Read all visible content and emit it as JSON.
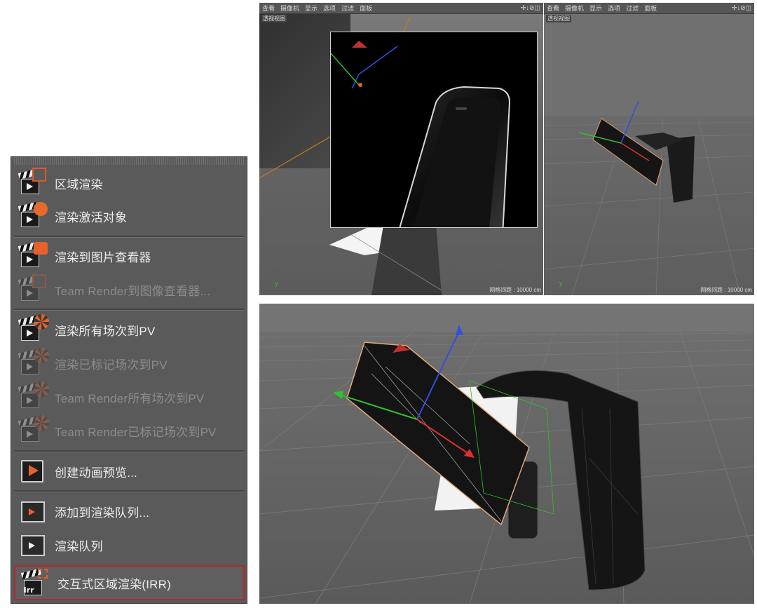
{
  "render_menu": {
    "items": [
      {
        "label": "区域渲染",
        "enabled": true,
        "icon": "region-render-icon"
      },
      {
        "label": "渲染激活对象",
        "enabled": true,
        "icon": "render-active-objects-icon"
      },
      {
        "label": "渲染到图片查看器",
        "enabled": true,
        "icon": "render-to-picture-viewer-icon"
      },
      {
        "label": "Team Render到图像查看器...",
        "enabled": false,
        "icon": "team-render-picture-viewer-icon"
      },
      {
        "label": "渲染所有场次到PV",
        "enabled": true,
        "icon": "render-all-takes-icon"
      },
      {
        "label": "渲染已标记场次到PV",
        "enabled": false,
        "icon": "render-marked-takes-icon"
      },
      {
        "label": "Team Render所有场次到PV",
        "enabled": false,
        "icon": "team-render-all-takes-icon"
      },
      {
        "label": "Team Render已标记场次到PV",
        "enabled": false,
        "icon": "team-render-marked-takes-icon"
      },
      {
        "label": "创建动画预览...",
        "enabled": true,
        "icon": "make-preview-icon"
      },
      {
        "label": "添加到渲染队列...",
        "enabled": true,
        "icon": "add-to-render-queue-icon"
      },
      {
        "label": "渲染队列",
        "enabled": true,
        "icon": "render-queue-icon"
      },
      {
        "label": "交互式区域渲染(IRR)",
        "enabled": true,
        "icon": "interactive-region-render-icon",
        "highlighted": true
      }
    ],
    "irr_badge": "irr"
  },
  "viewport_menu": [
    "查看",
    "摄像机",
    "显示",
    "选项",
    "过滤",
    "面板"
  ],
  "viewport_nav_icons": "✢↓⊘◫",
  "viewports": {
    "top_left": {
      "label": "透视视图",
      "grid": "网格间距 : 10000 cm"
    },
    "top_right": {
      "label": "透视视图",
      "grid": "网格间距 : 10000 cm"
    }
  },
  "colors": {
    "menu_bg": "#5a5a5a",
    "highlight_border": "#b02a2a",
    "accent_orange": "#e8602a",
    "viewport_bg": "#6c6c6c",
    "axis_x": "#e03030",
    "axis_y": "#30c030",
    "axis_z": "#3050e0"
  }
}
